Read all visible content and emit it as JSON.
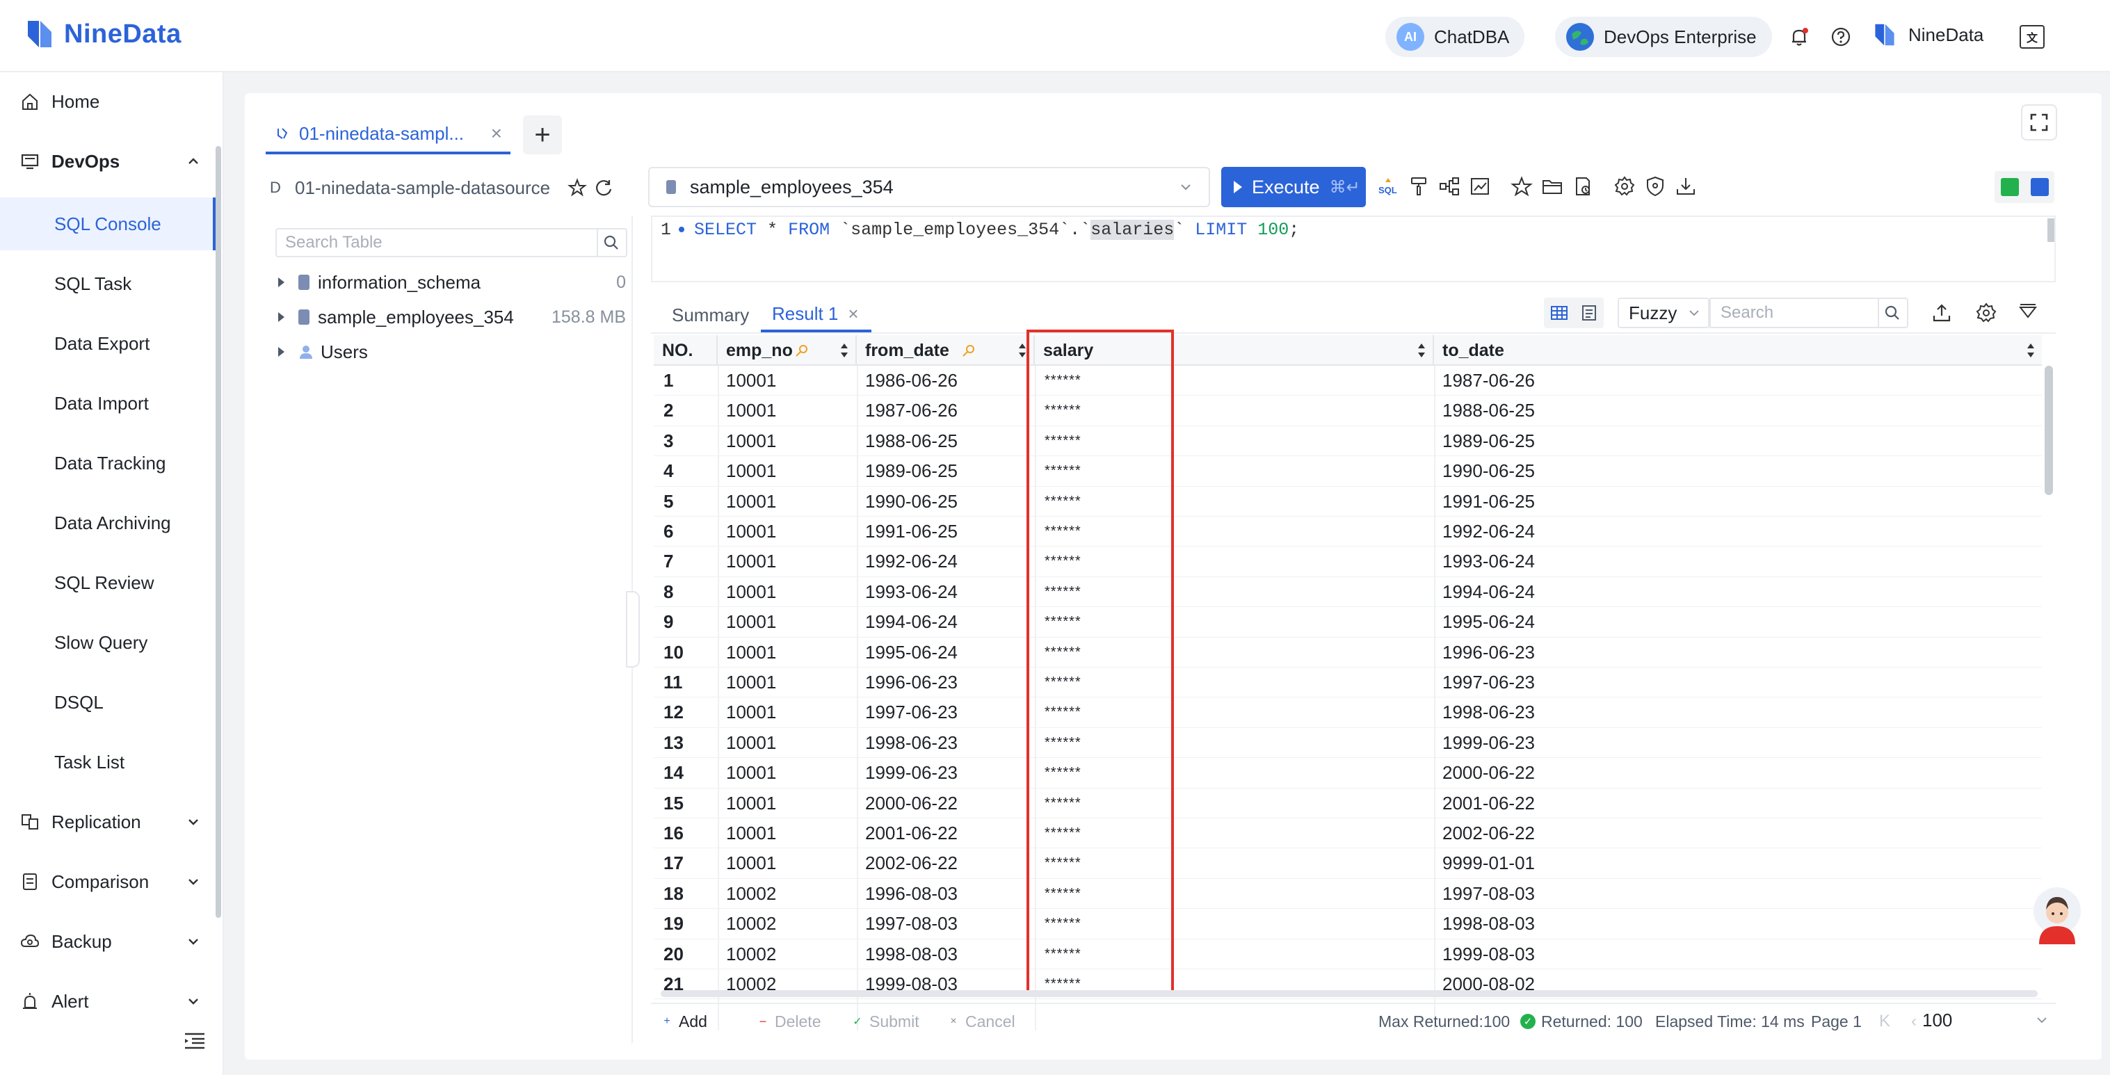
{
  "brand": {
    "name": "NineData",
    "color": "#2b63d9"
  },
  "header": {
    "chatdba": "ChatDBA",
    "chatdba_badge": "AI",
    "edition": "DevOps Enterprise",
    "user": "NineData",
    "icons": [
      "bell-icon",
      "help-icon",
      "language-icon"
    ]
  },
  "sidebar": {
    "home": "Home",
    "devops": "DevOps",
    "devops_items": [
      "SQL Console",
      "SQL Task",
      "Data Export",
      "Data Import",
      "Data Tracking",
      "Data Archiving",
      "SQL Review",
      "Slow Query",
      "DSQL",
      "Task List"
    ],
    "active_item": "SQL Console",
    "replication": "Replication",
    "comparison": "Comparison",
    "backup": "Backup",
    "alert": "Alert"
  },
  "tabs": {
    "active": "01-ninedata-sampl...",
    "close": "×",
    "add": "+"
  },
  "datasource": {
    "prefix": "D",
    "name": "01-ninedata-sample-datasource"
  },
  "tree": {
    "search_placeholder": "Search Table",
    "items": [
      {
        "name": "information_schema",
        "meta": "0",
        "kind": "db"
      },
      {
        "name": "sample_employees_354",
        "meta": "158.8 MB",
        "kind": "db"
      },
      {
        "name": "Users",
        "meta": "",
        "kind": "users"
      }
    ]
  },
  "toolbar": {
    "database": "sample_employees_354",
    "execute_label": "Execute",
    "execute_shortcut": "⌘↵"
  },
  "editor": {
    "line_number": "1",
    "sql": {
      "select": "SELECT",
      "star": "*",
      "from": "FROM",
      "schema": "`sample_employees_354`",
      "dot": ".",
      "tick_open": "`",
      "table": "salaries",
      "tick_close": "`",
      "limit": "LIMIT",
      "count": "100",
      "semi": ";"
    }
  },
  "result": {
    "summary_tab": "Summary",
    "result_tab": "Result 1",
    "search_mode": "Fuzzy",
    "search_placeholder": "Search",
    "columns": [
      "NO.",
      "emp_no",
      "from_date",
      "salary",
      "to_date"
    ],
    "rows": [
      [
        "1",
        "10001",
        "1986-06-26",
        "******",
        "1987-06-26"
      ],
      [
        "2",
        "10001",
        "1987-06-26",
        "******",
        "1988-06-25"
      ],
      [
        "3",
        "10001",
        "1988-06-25",
        "******",
        "1989-06-25"
      ],
      [
        "4",
        "10001",
        "1989-06-25",
        "******",
        "1990-06-25"
      ],
      [
        "5",
        "10001",
        "1990-06-25",
        "******",
        "1991-06-25"
      ],
      [
        "6",
        "10001",
        "1991-06-25",
        "******",
        "1992-06-24"
      ],
      [
        "7",
        "10001",
        "1992-06-24",
        "******",
        "1993-06-24"
      ],
      [
        "8",
        "10001",
        "1993-06-24",
        "******",
        "1994-06-24"
      ],
      [
        "9",
        "10001",
        "1994-06-24",
        "******",
        "1995-06-24"
      ],
      [
        "10",
        "10001",
        "1995-06-24",
        "******",
        "1996-06-23"
      ],
      [
        "11",
        "10001",
        "1996-06-23",
        "******",
        "1997-06-23"
      ],
      [
        "12",
        "10001",
        "1997-06-23",
        "******",
        "1998-06-23"
      ],
      [
        "13",
        "10001",
        "1998-06-23",
        "******",
        "1999-06-23"
      ],
      [
        "14",
        "10001",
        "1999-06-23",
        "******",
        "2000-06-22"
      ],
      [
        "15",
        "10001",
        "2000-06-22",
        "******",
        "2001-06-22"
      ],
      [
        "16",
        "10001",
        "2001-06-22",
        "******",
        "2002-06-22"
      ],
      [
        "17",
        "10001",
        "2002-06-22",
        "******",
        "9999-01-01"
      ],
      [
        "18",
        "10002",
        "1996-08-03",
        "******",
        "1997-08-03"
      ],
      [
        "19",
        "10002",
        "1997-08-03",
        "******",
        "1998-08-03"
      ],
      [
        "20",
        "10002",
        "1998-08-03",
        "******",
        "1999-08-03"
      ],
      [
        "21",
        "10002",
        "1999-08-03",
        "******",
        "2000-08-02"
      ]
    ]
  },
  "footer": {
    "add": "Add",
    "delete": "Delete",
    "submit": "Submit",
    "cancel": "Cancel",
    "max_returned": "Max Returned:100",
    "returned": "Returned: 100",
    "elapsed": "Elapsed Time: 14 ms",
    "page": "Page 1",
    "page_size": "100"
  },
  "colors": {
    "accent": "#2b63d9",
    "highlight_border": "#e3302b",
    "success": "#23b14d"
  }
}
